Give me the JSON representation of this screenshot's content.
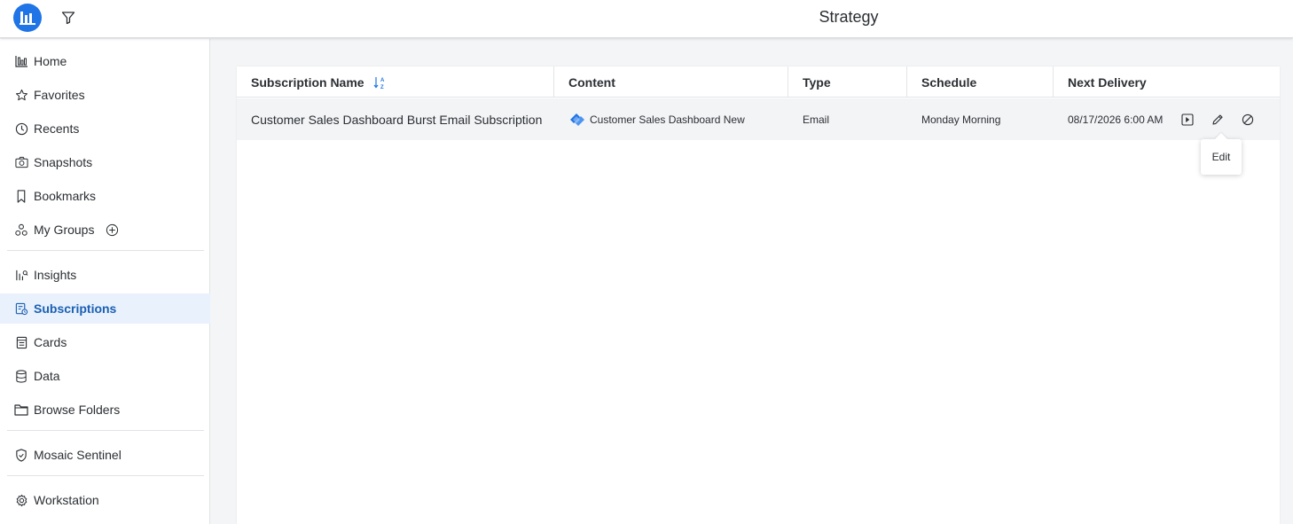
{
  "app": {
    "title": "Strategy"
  },
  "header": {
    "logo_icon": "bar-chart-logo-icon",
    "filter_icon": "filter-icon"
  },
  "sidebar": {
    "items": [
      {
        "label": "Home",
        "icon": "bar-chart-icon",
        "active": false
      },
      {
        "label": "Favorites",
        "icon": "star-icon",
        "active": false
      },
      {
        "label": "Recents",
        "icon": "clock-icon",
        "active": false
      },
      {
        "label": "Snapshots",
        "icon": "camera-icon",
        "active": false
      },
      {
        "label": "Bookmarks",
        "icon": "bookmark-icon",
        "active": false
      },
      {
        "label": "My Groups",
        "icon": "groups-icon",
        "active": false,
        "add_icon": "plus-circle-icon"
      },
      {
        "label": "Insights",
        "icon": "insights-icon",
        "active": false
      },
      {
        "label": "Subscriptions",
        "icon": "subscriptions-icon",
        "active": true
      },
      {
        "label": "Cards",
        "icon": "cards-icon",
        "active": false
      },
      {
        "label": "Data",
        "icon": "database-icon",
        "active": false
      },
      {
        "label": "Browse Folders",
        "icon": "folder-icon",
        "active": false
      },
      {
        "label": "Mosaic Sentinel",
        "icon": "shield-icon",
        "active": false
      },
      {
        "label": "Workstation",
        "icon": "gear-icon",
        "active": false
      }
    ]
  },
  "table": {
    "columns": [
      "Subscription Name",
      "Content",
      "Type",
      "Schedule",
      "Next Delivery"
    ],
    "sort_icon": "sort-az-icon",
    "rows": [
      {
        "name": "Customer Sales Dashboard Burst Email Subscription",
        "content": "Customer Sales Dashboard New",
        "type": "Email",
        "schedule": "Monday Morning",
        "next_delivery": "08/17/2026 6:00 AM"
      }
    ],
    "row_actions": [
      "run-icon",
      "edit-icon",
      "unsubscribe-icon"
    ]
  },
  "tooltip": {
    "text": "Edit"
  },
  "colors": {
    "accent": "#1f74e6",
    "active_bg": "#e8f1fc",
    "active_text": "#1a5fb4"
  }
}
